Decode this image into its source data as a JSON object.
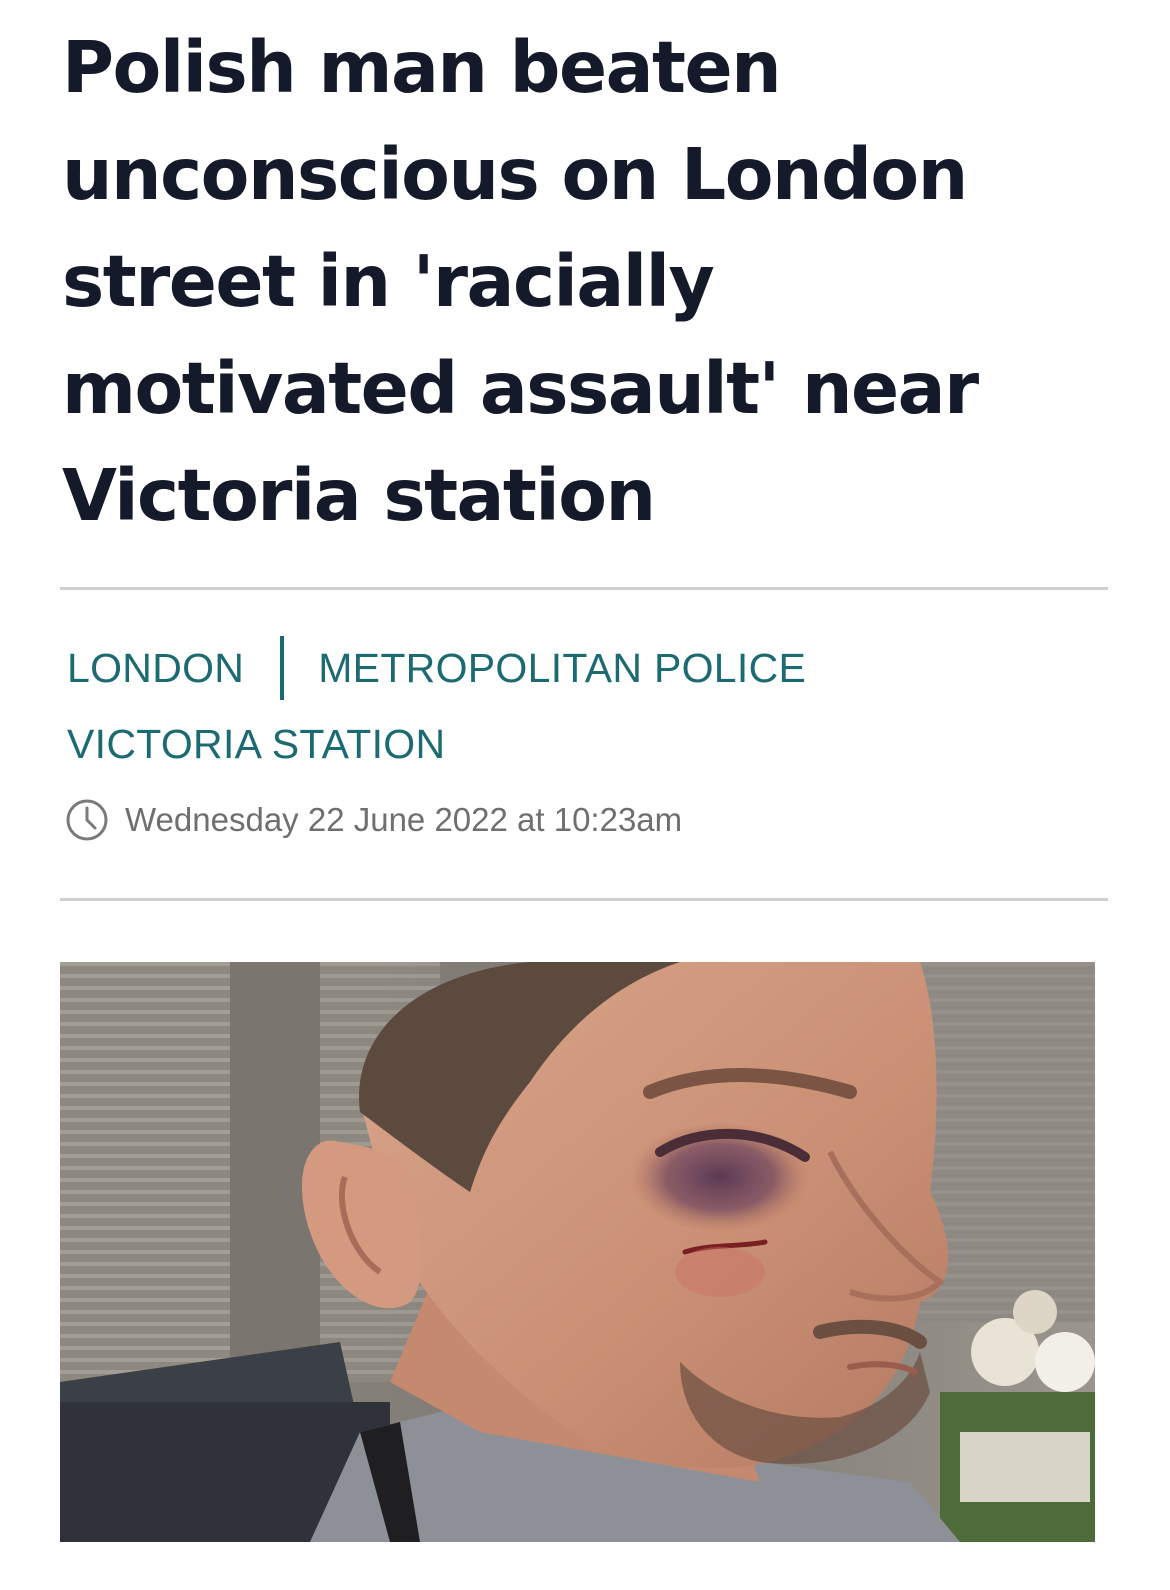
{
  "article": {
    "headline": "Polish man beaten unconscious on London street in 'racially motivated assault' near Victoria station",
    "tags": [
      "LONDON",
      "METROPOLITAN POLICE",
      "VICTORIA STATION"
    ],
    "date": "Wednesday 22 June 2022 at 10:23am",
    "hero_image": {
      "icon": "photo-man-with-bruised-eye"
    }
  },
  "colors": {
    "headline": "#151a2a",
    "tag": "#1d6b72",
    "meta": "#6f6f6f",
    "rule": "#cfcfcf"
  }
}
